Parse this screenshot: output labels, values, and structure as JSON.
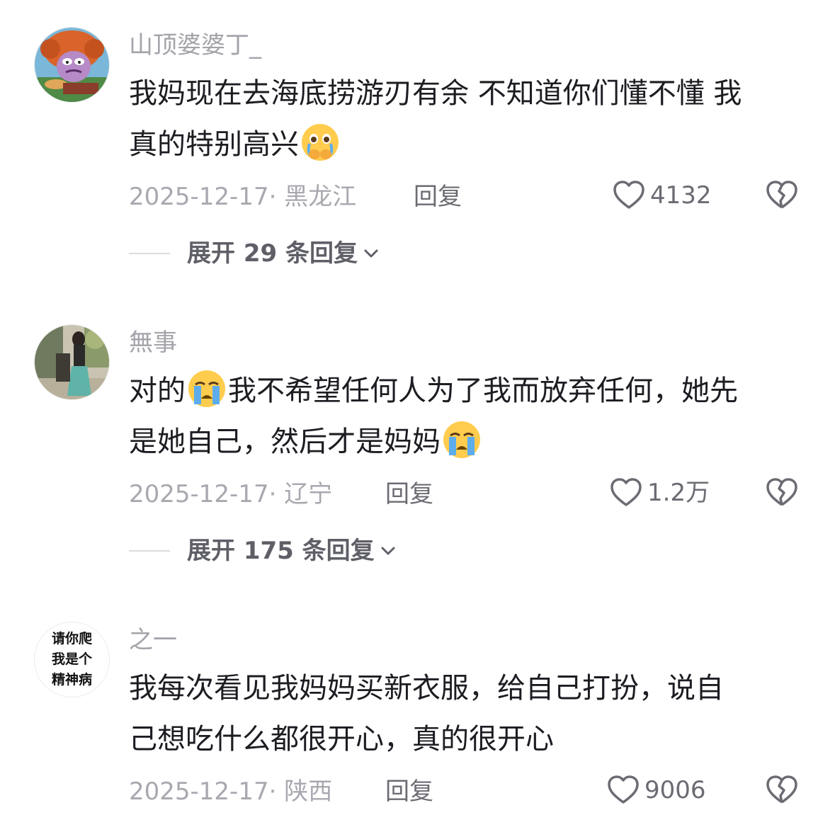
{
  "comments": [
    {
      "username": "山顶婆婆丁_",
      "text_line1": "我妈现在去海底捞游刃有余 不知道你们懂不懂 我",
      "text_line2": "真的特别高兴",
      "emoji": "pleading-face-crying-icon",
      "date_location": "2025-12-17· 黑龙江",
      "reply_label": "回复",
      "likes": "4132",
      "expand_label": "展开 29 条回复"
    },
    {
      "username": "無事",
      "text_line1_a": "对的",
      "text_line1_b": "我不希望任何人为了我而放弃任何，她先",
      "text_line2": "是她自己，然后才是妈妈",
      "emoji": "loudly-crying-face-icon",
      "date_location": "2025-12-17· 辽宁",
      "reply_label": "回复",
      "likes": "1.2万",
      "expand_label": "展开 175 条回复"
    },
    {
      "username": "之一",
      "avatar_text": [
        "请你爬",
        "我是个",
        "精神病"
      ],
      "text_line1": "我每次看见我妈妈买新衣服，给自己打扮，说自",
      "text_line2": "己想吃什么都很开心，真的很开心",
      "date_location": "2025-12-17· 陕西",
      "reply_label": "回复",
      "likes": "9006"
    }
  ],
  "colors": {
    "username": "#a3a3aa",
    "content": "#1c1c22",
    "meta": "#a8a8b0",
    "action": "#6b6b73"
  }
}
